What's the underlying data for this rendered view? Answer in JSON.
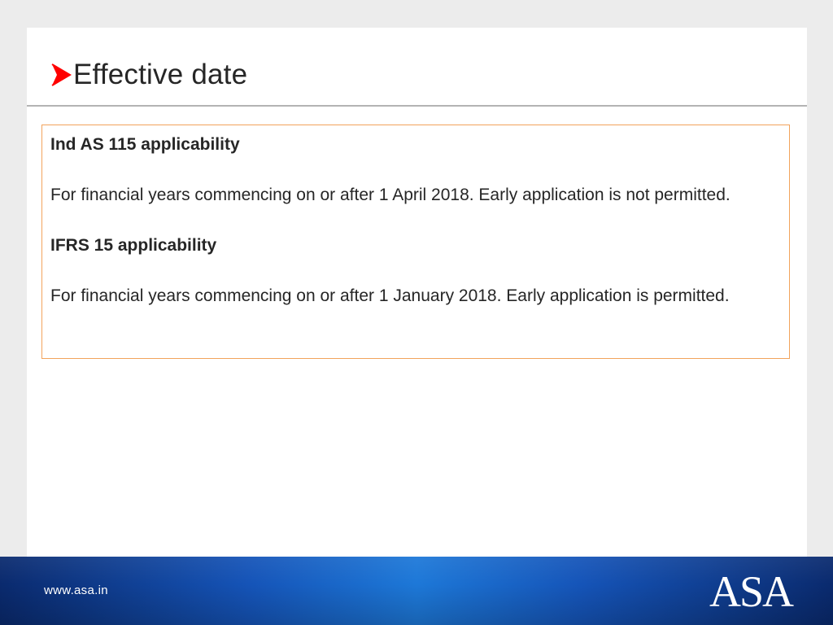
{
  "slide": {
    "title": "Effective date",
    "bullet_icon": "arrow-right-icon",
    "accent_color": "#ff0000"
  },
  "content": {
    "heading_1": "Ind AS 115 applicability",
    "text_1": "For financial years commencing on or after 1 April 2018. Early application is not permitted.",
    "heading_2": "IFRS 15 applicability",
    "text_2": "For financial years commencing on or after 1 January 2018. Early application is permitted."
  },
  "footer": {
    "url": "www.asa.in",
    "logo_text": "ASA"
  }
}
